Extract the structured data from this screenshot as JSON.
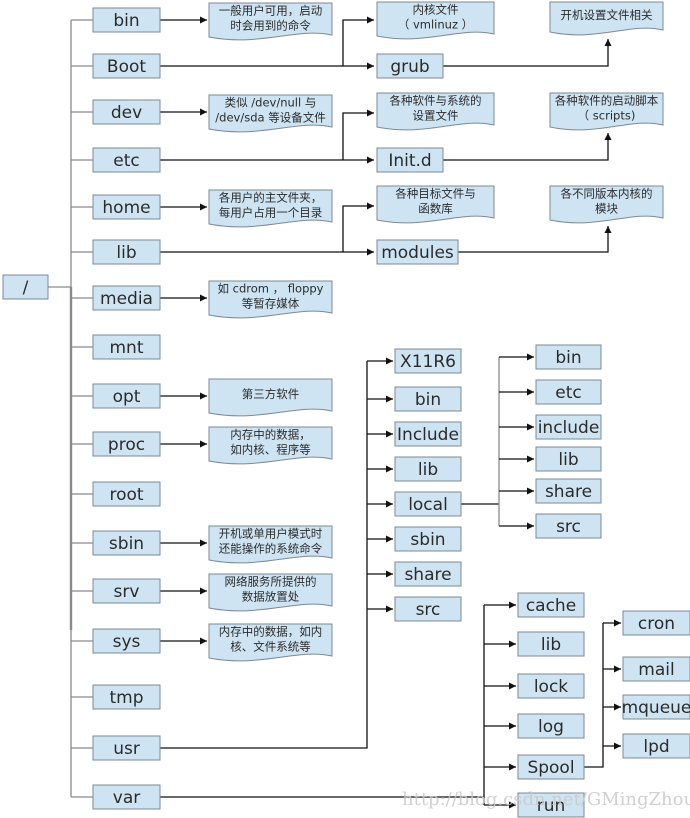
{
  "root": {
    "label": "/"
  },
  "top_dirs": [
    {
      "id": "bin",
      "label": "bin",
      "note": [
        "一般用户可用，启动",
        "时会用到的命令"
      ]
    },
    {
      "id": "boot",
      "label": "Boot"
    },
    {
      "id": "dev",
      "label": "dev",
      "note": [
        "类似 /dev/null 与",
        "/dev/sda 等设备文件"
      ]
    },
    {
      "id": "etc",
      "label": "etc"
    },
    {
      "id": "home",
      "label": "home",
      "note": [
        "各用户的主文件夹，",
        "每用户占用一个目录"
      ]
    },
    {
      "id": "lib",
      "label": "lib"
    },
    {
      "id": "media",
      "label": "media",
      "note": [
        "如 cdrom ， floppy",
        "等暂存媒体"
      ]
    },
    {
      "id": "mnt",
      "label": "mnt"
    },
    {
      "id": "opt",
      "label": "opt",
      "note": [
        "第三方软件"
      ]
    },
    {
      "id": "proc",
      "label": "proc",
      "note": [
        "内存中的数据，",
        "如内核、程序等"
      ]
    },
    {
      "id": "root",
      "label": "root"
    },
    {
      "id": "sbin",
      "label": "sbin",
      "note": [
        "开机或单用户模式时",
        "还能操作的系统命令"
      ]
    },
    {
      "id": "srv",
      "label": "srv",
      "note": [
        "网络服务所提供的",
        "数据放置处"
      ]
    },
    {
      "id": "sys",
      "label": "sys",
      "note": [
        "内存中的数据，如内",
        "核、文件系统等"
      ]
    },
    {
      "id": "tmp",
      "label": "tmp"
    },
    {
      "id": "usr",
      "label": "usr"
    },
    {
      "id": "var",
      "label": "var"
    }
  ],
  "boot_branch": {
    "kernel_note": [
      "内核文件",
      "（ vmlinuz ）"
    ],
    "grub": "grub",
    "grub_note": [
      "开机设置文件相关"
    ]
  },
  "etc_branch": {
    "config_note": [
      "各种软件与系统的",
      "设置文件"
    ],
    "initd": "Init.d",
    "initd_note": [
      "各种软件的启动脚本",
      "（ scripts)"
    ]
  },
  "lib_branch": {
    "objects_note": [
      "各种目标文件与",
      "函数库"
    ],
    "modules": "modules",
    "modules_note": [
      "各不同版本内核的",
      "模块"
    ]
  },
  "usr_children": [
    "X11R6",
    "bin",
    "Include",
    "lib",
    "local",
    "sbin",
    "share",
    "src"
  ],
  "local_children": [
    "bin",
    "etc",
    "include",
    "lib",
    "share",
    "src"
  ],
  "var_children": [
    "cache",
    "lib",
    "lock",
    "log",
    "Spool",
    "run"
  ],
  "spool_children": [
    "cron",
    "mail",
    "mqueue",
    "lpd"
  ],
  "watermark": "http://blog.csdn.net/GMingZhou"
}
